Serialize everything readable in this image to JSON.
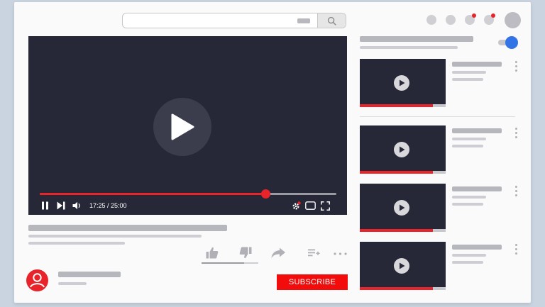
{
  "player": {
    "time_display": "17:25 / 25:00",
    "progress_fraction": 0.76
  },
  "channel": {
    "subscribe_label": "SUBSCRIBE"
  },
  "colors": {
    "accent_red": "#e8232a",
    "subscribe_red": "#f20c0c",
    "toggle_blue": "#3274e6",
    "player_bg": "#262837"
  },
  "recommendations": [
    {
      "progress_fraction": 0.85
    },
    {
      "progress_fraction": 0.85
    },
    {
      "progress_fraction": 0.85
    },
    {
      "progress_fraction": 0.85
    }
  ],
  "icons": {
    "search": "search-icon",
    "notifications": "bell-icon",
    "play": "play-icon",
    "pause": "pause-icon",
    "next": "skip-next-icon",
    "volume": "volume-icon",
    "settings": "gear-icon",
    "miniplayer": "miniplayer-icon",
    "fullscreen": "fullscreen-icon",
    "like": "thumbs-up-icon",
    "dislike": "thumbs-down-icon",
    "share": "share-icon",
    "save": "add-to-playlist-icon",
    "more": "more-horizontal-icon",
    "menu": "kebab-menu-icon"
  }
}
